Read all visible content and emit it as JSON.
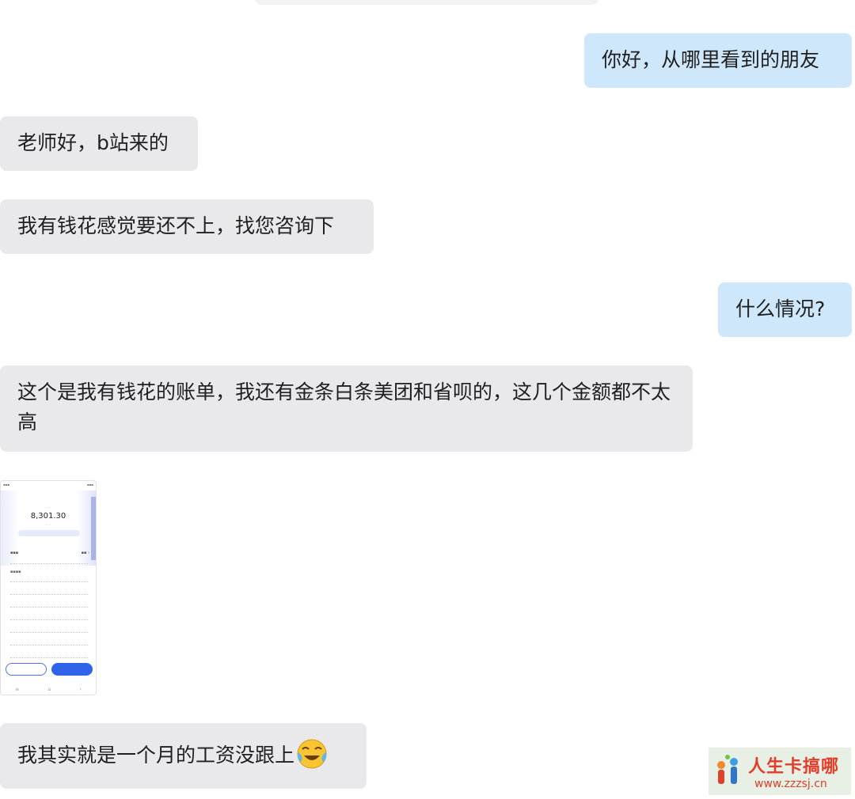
{
  "messages": [
    {
      "side": "out",
      "text": "你好，从哪里看到的朋友"
    },
    {
      "side": "in",
      "text": "老师好，b站来的"
    },
    {
      "side": "in",
      "text": "我有钱花感觉要还不上，找您咨询下"
    },
    {
      "side": "out",
      "text": "什么情况?"
    },
    {
      "side": "in",
      "text": "这个是我有钱花的账单，我还有金条白条美团和省呗的，这几个金额都不太高"
    },
    {
      "side": "in",
      "text": "我其实就是一个月的工资没跟上",
      "emoji": "crying-laughing-face-icon"
    }
  ],
  "image_attachment": {
    "amount": "8,301.30"
  },
  "watermark": {
    "brand": "人生卡搞哪",
    "url": "www.zzzsj.cn"
  },
  "colors": {
    "outgoing_bubble": "#cfe7fb",
    "incoming_bubble": "#e9e9eb",
    "watermark_red": "#e23d2a"
  }
}
